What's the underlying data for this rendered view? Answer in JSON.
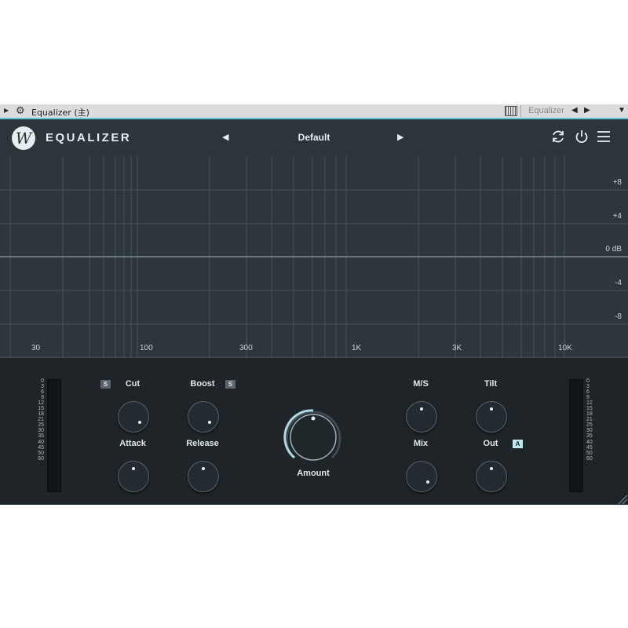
{
  "host": {
    "title": "Equalizer (主)",
    "plugin_name": "Equalizer"
  },
  "plugin": {
    "name": "EQUALIZER",
    "preset": "Default"
  },
  "graph": {
    "db_labels": [
      "+8",
      "+4",
      "0 dB",
      "-4",
      "-8"
    ],
    "hz_labels": [
      "30",
      "100",
      "300",
      "1K",
      "3K",
      "10K"
    ]
  },
  "meters": {
    "scale": [
      "0",
      "3",
      "6",
      "9",
      "12",
      "15",
      "18",
      "21",
      "25",
      "30",
      "35",
      "40",
      "45",
      "50",
      "60"
    ]
  },
  "controls": {
    "cut": "Cut",
    "boost": "Boost",
    "attack": "Attack",
    "release": "Release",
    "amount": "Amount",
    "ms": "M/S",
    "tilt": "Tilt",
    "mix": "Mix",
    "out": "Out",
    "solo": "S",
    "auto": "A"
  },
  "colors": {
    "accent": "#5ec8d8",
    "panel": "#2c353b",
    "controls_bg": "#1e2428"
  }
}
